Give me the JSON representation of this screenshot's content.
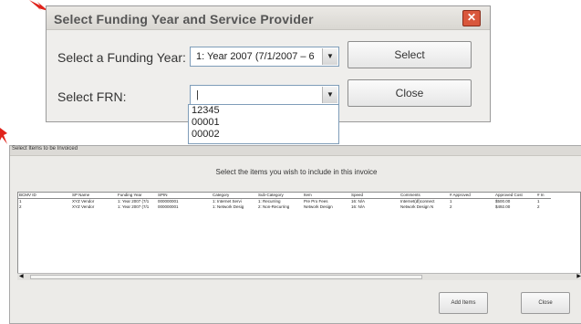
{
  "colors": {
    "arrow": "#e0231b",
    "close_button": "#d9573c"
  },
  "dialog1": {
    "title": "Select Funding Year and Service Provider",
    "funding_year_label": "Select a Funding Year:",
    "funding_year_value": "1: Year 2007 (7/1/2007 – 6",
    "frn_label": "Select FRN:",
    "frn_value": "|",
    "frn_options": [
      "12345",
      "00001",
      "00002"
    ],
    "select_label": "Select",
    "close_label": "Close"
  },
  "dialog2": {
    "title": "Select Items to be Invoiced",
    "instruction": "Select the items you wish to include in this invoice",
    "columns": [
      "BCMV ID",
      "SP Name",
      "Funding Year",
      "SPIN",
      "Category",
      "Sub-Category",
      "Item",
      "Speed",
      "Comments",
      "# Approved",
      "Approved Cost",
      "# In"
    ],
    "rows": [
      [
        "1",
        "XYZ Vendor",
        "1: Year 2007 (7/1",
        "000000001",
        "1: Internet Servi",
        "1: Recurring",
        "Pre Pro Fees",
        "16: N/A",
        "Internet(dl)connect",
        "1",
        "$500.00",
        "1"
      ],
      [
        "2",
        "XYZ Vendor",
        "1: Year 2007 (7/1",
        "000000001",
        "1: Network Desig",
        "2: Non-Recurring",
        "Network Design",
        "16: N/A",
        "Network Design N",
        "2",
        "$492.00",
        "2"
      ]
    ],
    "add_items_label": "Add Items",
    "close_label": "Close"
  }
}
